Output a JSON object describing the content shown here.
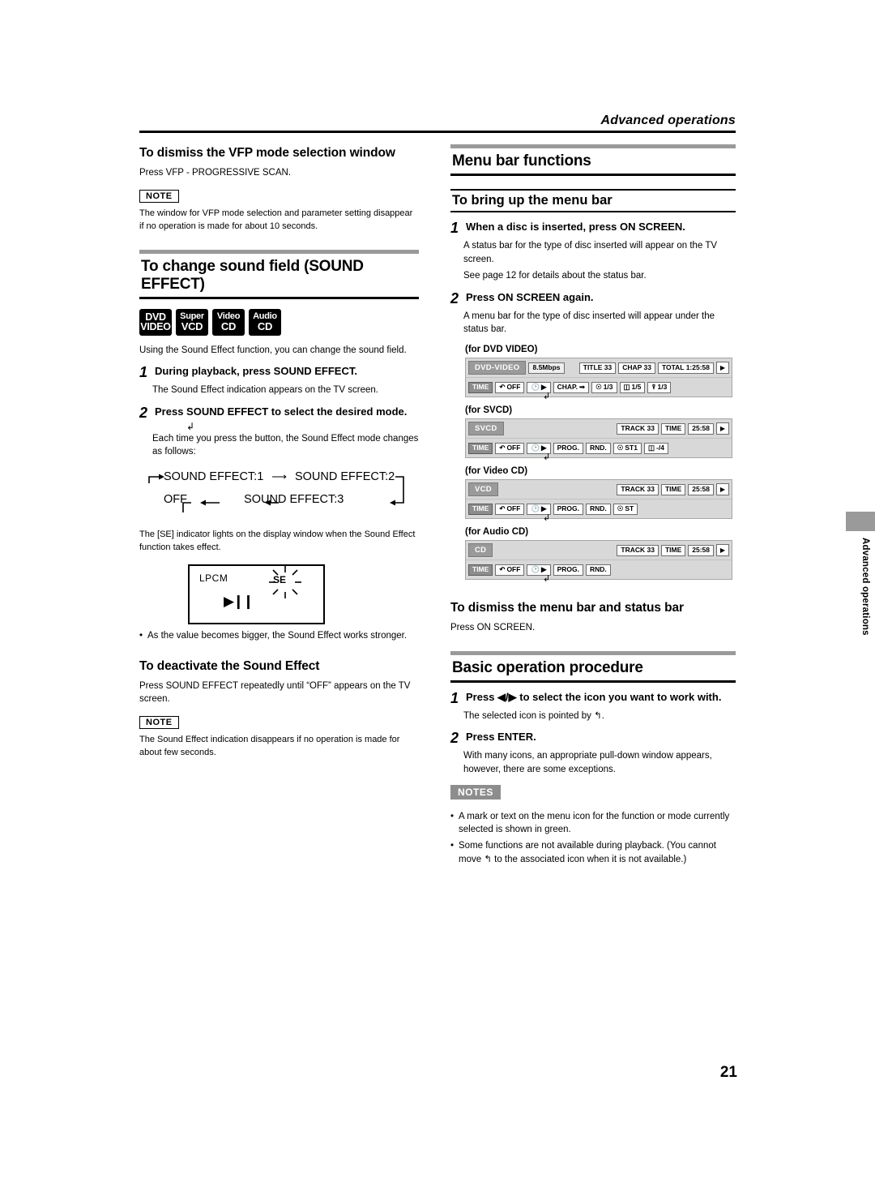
{
  "header": {
    "title": "Advanced operations"
  },
  "page_number": "21",
  "side_tab": {
    "label": "Advanced operations"
  },
  "left": {
    "vfp": {
      "heading": "To dismiss the VFP mode selection window",
      "body": "Press VFP - PROGRESSIVE SCAN.",
      "note_badge": "NOTE",
      "note_text": "The window for VFP mode selection and parameter setting disappear if no operation is made for about 10 seconds."
    },
    "sound_effect": {
      "section_title": "To change sound field (SOUND EFFECT)",
      "discs": [
        {
          "line1": "DVD",
          "line2": "VIDEO"
        },
        {
          "line1": "Super",
          "line2": "VCD"
        },
        {
          "line1": "Video",
          "line2": "CD"
        },
        {
          "line1": "Audio",
          "line2": "CD"
        }
      ],
      "intro": "Using the Sound Effect function, you can change the sound field.",
      "steps": [
        {
          "num": "1",
          "title": "During playback, press SOUND EFFECT.",
          "body": "The Sound Effect indication appears on the TV screen."
        },
        {
          "num": "2",
          "title": "Press SOUND EFFECT  to select the desired mode.",
          "body": "Each time you press the button, the Sound Effect mode changes as follows:"
        }
      ],
      "cycle": {
        "item1": "SOUND EFFECT:1",
        "item2": "SOUND EFFECT:2",
        "item3": "SOUND EFFECT:3",
        "item4": "OFF"
      },
      "after_cycle": "The [SE] indicator lights on the display window when the Sound Effect function takes effect.",
      "display_window": {
        "lpcm": "LPCM",
        "se": "SE",
        "play": "▶❙❙"
      },
      "bullet": "As the value becomes bigger, the Sound Effect works stronger."
    },
    "deactivate": {
      "heading": "To deactivate the Sound Effect",
      "body": "Press SOUND EFFECT repeatedly until “OFF” appears on the TV screen.",
      "note_badge": "NOTE",
      "note_text": "The Sound Effect indication disappears if no operation is made for about few seconds."
    }
  },
  "right": {
    "menu_bar": {
      "section_title": "Menu bar functions"
    },
    "bring_up": {
      "heading": "To bring up the menu bar",
      "steps": [
        {
          "num": "1",
          "title": "When a disc is inserted, press ON SCREEN.",
          "body": "A status bar for the type of disc inserted will appear on the TV screen.",
          "body2": "See page 12 for details about the status bar."
        },
        {
          "num": "2",
          "title": "Press ON SCREEN again.",
          "body": "A menu bar for the type of disc inserted will appear under the status bar."
        }
      ]
    },
    "osd": [
      {
        "label": "(for DVD VIDEO)",
        "disc_tag": "DVD-VIDEO",
        "top_chips": [
          "8.5Mbps",
          "TITLE 33",
          "CHAP 33",
          "TOTAL 1:25:58",
          "▶"
        ],
        "bottom_chips": [
          "TIME",
          "OFF",
          "▶",
          "CHAP.",
          "1/3",
          "1/5",
          "1/3"
        ]
      },
      {
        "label": "(for SVCD)",
        "disc_tag": "SVCD",
        "top_chips": [
          "TRACK 33",
          "TIME",
          "25:58",
          "▶"
        ],
        "bottom_chips": [
          "TIME",
          "OFF",
          "▶",
          "PROG.",
          "RND.",
          "ST1",
          "-/4"
        ]
      },
      {
        "label": "(for Video CD)",
        "disc_tag": "VCD",
        "top_chips": [
          "TRACK 33",
          "TIME",
          "25:58",
          "▶"
        ],
        "bottom_chips": [
          "TIME",
          "OFF",
          "▶",
          "PROG.",
          "RND.",
          "ST"
        ]
      },
      {
        "label": "(for Audio CD)",
        "disc_tag": "CD",
        "top_chips": [
          "TRACK 33",
          "TIME",
          "25:58",
          "▶"
        ],
        "bottom_chips": [
          "TIME",
          "OFF",
          "▶",
          "PROG.",
          "RND."
        ]
      }
    ],
    "dismiss": {
      "heading": "To dismiss the menu bar and status bar",
      "body": "Press ON SCREEN."
    },
    "basic": {
      "section_title": "Basic operation procedure",
      "steps": [
        {
          "num": "1",
          "title": "Press ◀/▶ to select the icon you want to work with.",
          "body": "The selected icon is pointed by ↰."
        },
        {
          "num": "2",
          "title": "Press ENTER.",
          "body": "With many icons, an appropriate pull-down window appears, however, there are some exceptions."
        }
      ],
      "notes_badge": "NOTES",
      "notes": [
        "A mark or text on the menu icon for the function or mode currently selected is shown in green.",
        "Some functions are not available during playback. (You cannot move ↰ to the associated icon when it is not available.)"
      ]
    }
  }
}
